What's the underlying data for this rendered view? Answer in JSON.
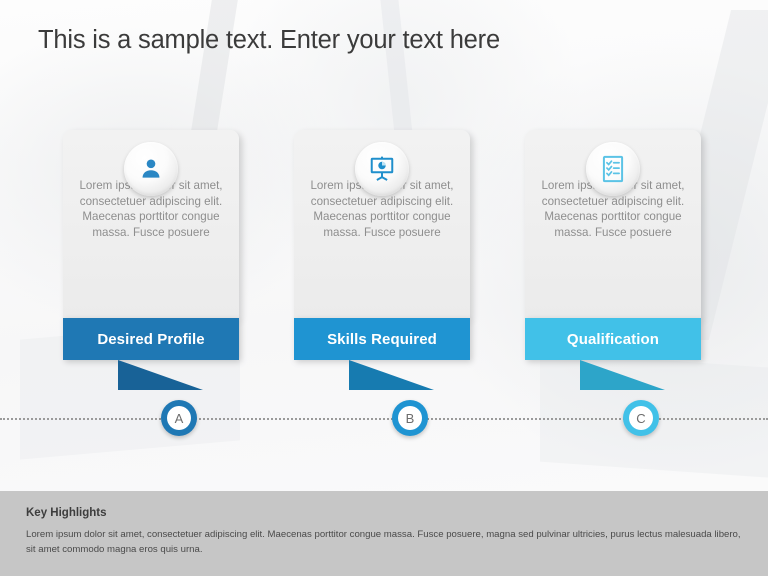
{
  "slide": {
    "title": "This is a sample text. Enter your text here"
  },
  "colors": {
    "card_1_accent": "#1f78b4",
    "card_1_accent_dark": "#186297",
    "card_2_accent": "#1f94d2",
    "card_2_accent_dark": "#177bb0",
    "card_3_accent": "#41c1e8",
    "card_3_accent_dark": "#2da5c9",
    "card_background": "#efefef",
    "body_text": "#8e8e8e",
    "footer_background": "#c6c6c6",
    "timeline": "#9a9a9a"
  },
  "cards": [
    {
      "icon": "person-icon",
      "body": "Lorem ipsum dolor sit amet, consectetuer adipiscing elit. Maecenas porttitor congue massa. Fusce posuere",
      "label": "Desired Profile",
      "marker": "A"
    },
    {
      "icon": "presentation-chart-icon",
      "body": "Lorem ipsum dolor sit amet, consectetuer adipiscing elit. Maecenas porttitor congue massa. Fusce posuere",
      "label": "Skills Required",
      "marker": "B"
    },
    {
      "icon": "checklist-icon",
      "body": "Lorem ipsum dolor sit amet, consectetuer adipiscing elit. Maecenas porttitor congue massa. Fusce posuere",
      "label": "Qualification",
      "marker": "C"
    }
  ],
  "highlights": {
    "title": "Key Highlights",
    "text": "Lorem ipsum dolor sit amet, consectetuer adipiscing elit. Maecenas porttitor congue massa. Fusce posuere, magna sed pulvinar ultricies, purus lectus malesuada libero, sit amet commodo magna eros quis urna."
  }
}
